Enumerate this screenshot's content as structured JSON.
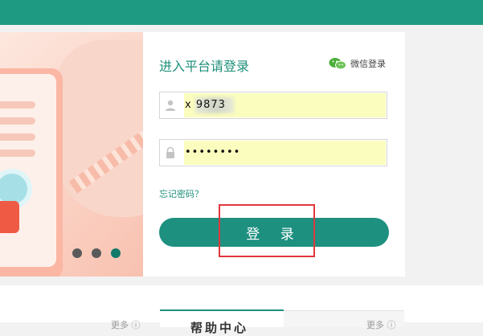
{
  "login": {
    "title": "进入平台请登录",
    "wechat_label": "微信登录",
    "username_value": "x      9873",
    "password_mask": "••••••••",
    "forgot_label": "忘记密码？",
    "login_button": "登 录"
  },
  "carousel": {
    "dot_count": 3,
    "active_index": 2
  },
  "bottom": {
    "more_left": "更多 ⓘ",
    "tab_active": "帮助中心",
    "more_right": "更多 ⓘ"
  },
  "colors": {
    "brand": "#1e9080",
    "highlight": "#e0373d",
    "autofill": "#fafdbd"
  },
  "icons": [
    "user-icon",
    "lock-icon",
    "wechat-icon"
  ]
}
